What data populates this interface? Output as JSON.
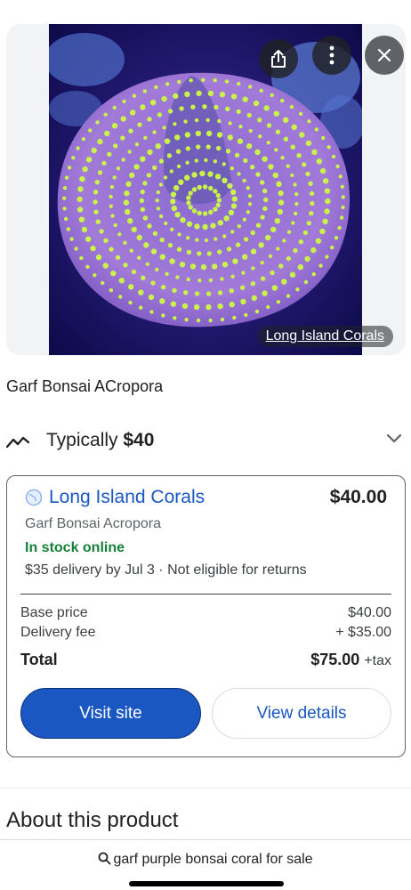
{
  "image": {
    "source_chip": "Long Island Corals",
    "icons": [
      "share-icon",
      "more-vert-icon",
      "close-icon"
    ]
  },
  "product": {
    "title": "Garf Bonsai ACropora"
  },
  "price_summary": {
    "typically_label": "Typically",
    "typically_value": "$40",
    "icons": [
      "trend-icon",
      "chevron-down-icon"
    ]
  },
  "offer": {
    "merchant": "Long Island Corals",
    "price": "$40.00",
    "product_name": "Garf Bonsai Acropora",
    "stock": "In stock online",
    "delivery": "$35 delivery by Jul 3 · Not eligible for returns",
    "base_price_label": "Base price",
    "base_price": "$40.00",
    "delivery_fee_label": "Delivery fee",
    "delivery_fee": "+ $35.00",
    "total_label": "Total",
    "total": "$75.00",
    "tax_note": "+tax",
    "visit_label": "Visit site",
    "details_label": "View details",
    "colors": {
      "link": "#1a57c2",
      "stock": "#188038"
    }
  },
  "about": {
    "heading": "About this product"
  },
  "search": {
    "query": "garf purple bonsai coral for sale"
  }
}
